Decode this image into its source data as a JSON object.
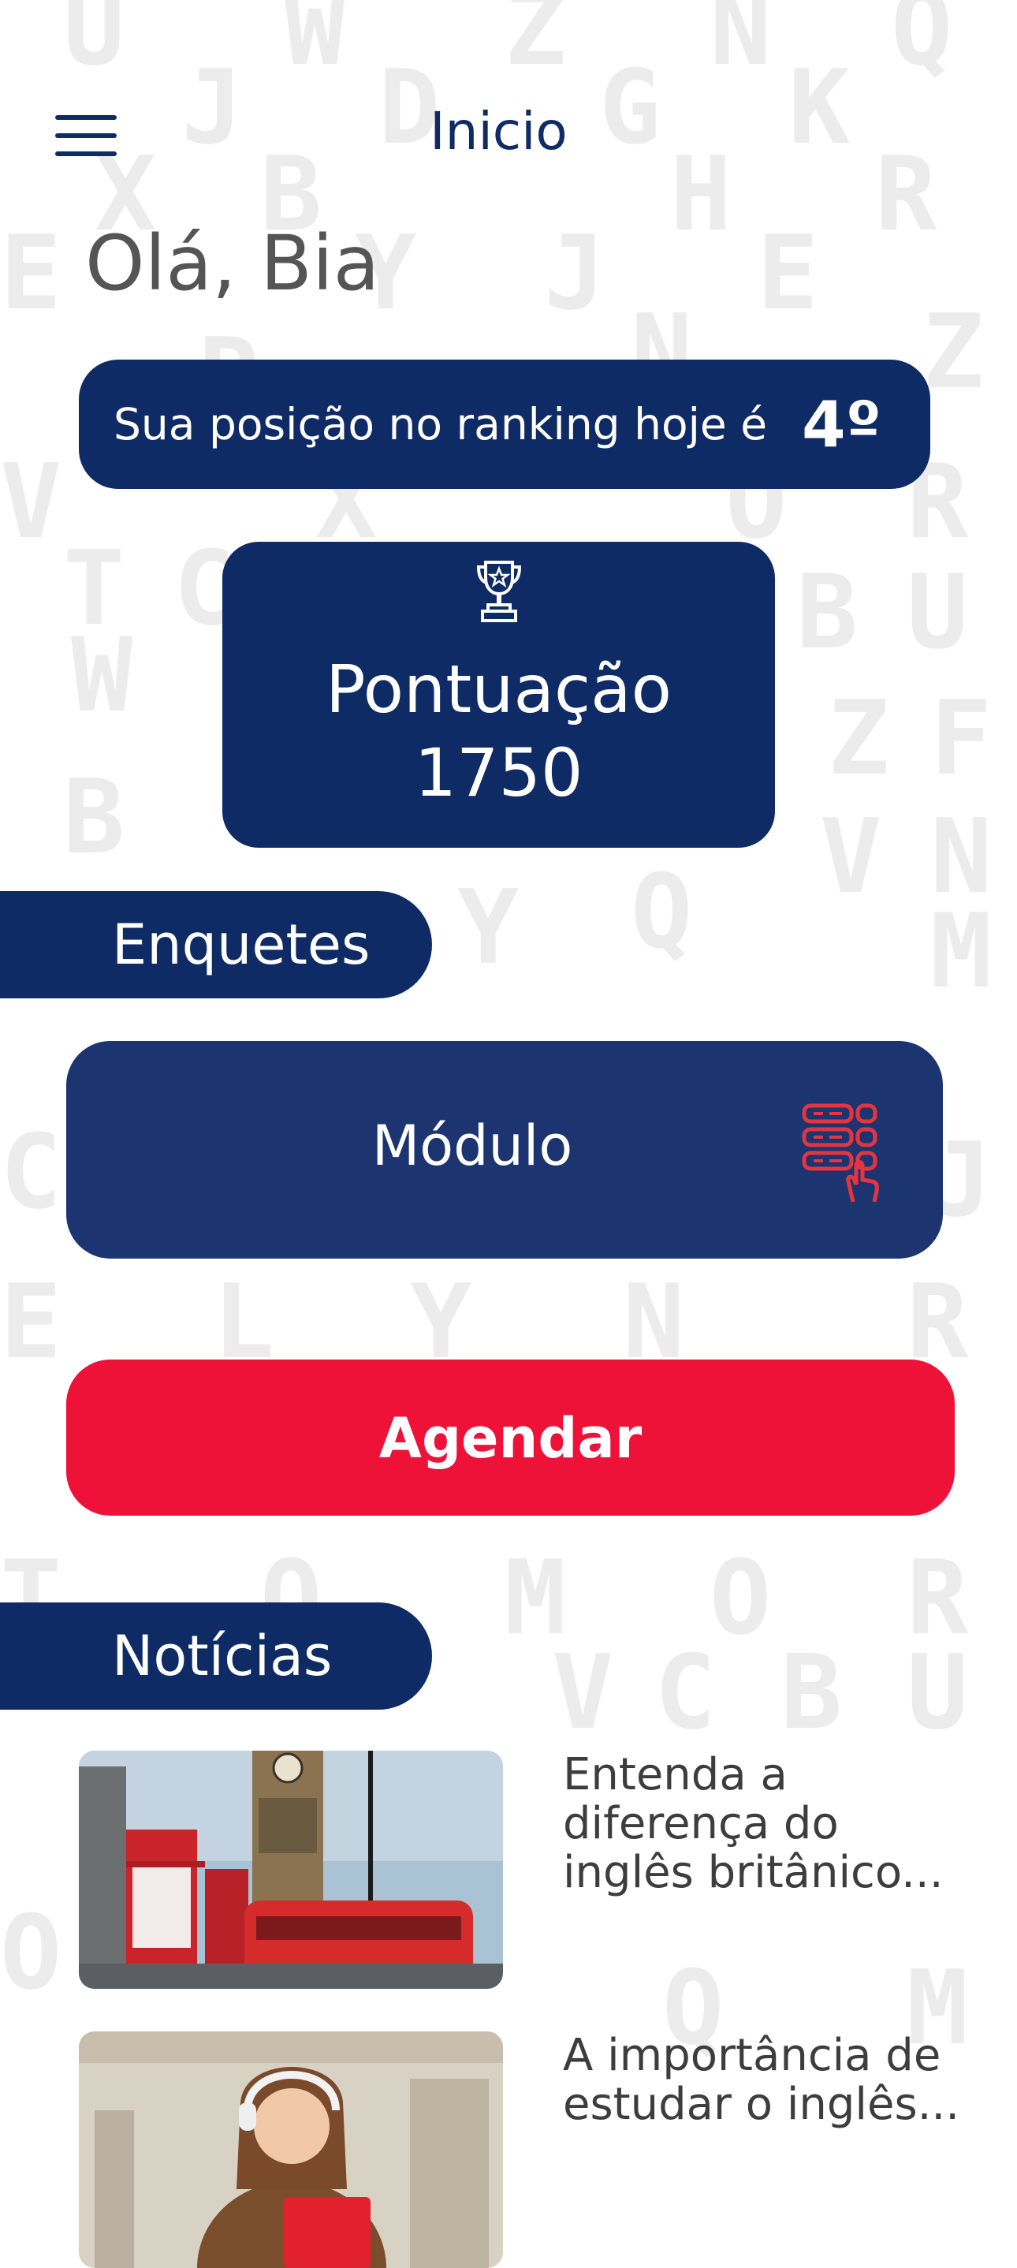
{
  "header": {
    "title": "Inicio",
    "menu_icon": "hamburger-menu-icon"
  },
  "greeting": "Olá, Bia",
  "ranking": {
    "text": "Sua posição no ranking hoje é",
    "position": "4º"
  },
  "score": {
    "icon": "trophy-icon",
    "label": "Pontuação",
    "value": "1750"
  },
  "sections": {
    "polls": "Enquetes",
    "news": "Notícias"
  },
  "module": {
    "label": "Módulo",
    "icon": "module-select-icon"
  },
  "schedule_button": "Agendar",
  "news": [
    {
      "title": "Entenda a diferença do inglês britânico..."
    },
    {
      "title": "A importância de estudar o inglês..."
    }
  ],
  "colors": {
    "navy": "#0f2b66",
    "module_navy": "#1c3470",
    "red": "#ee1138",
    "icon_red": "#e5343e"
  }
}
